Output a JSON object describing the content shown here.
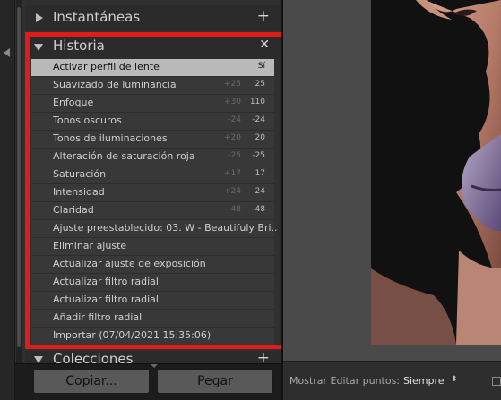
{
  "panel": {
    "snapshots_title": "Instantáneas",
    "history_title": "Historia",
    "collections_title": "Colecciones",
    "history_items": [
      {
        "label": "Activar perfil de lente",
        "delta": "",
        "value": "Sí",
        "selected": true
      },
      {
        "label": "Suavizado de luminancia",
        "delta": "+25",
        "value": "25"
      },
      {
        "label": "Enfoque",
        "delta": "+30",
        "value": "110"
      },
      {
        "label": "Tonos oscuros",
        "delta": "-24",
        "value": "-24"
      },
      {
        "label": "Tonos de iluminaciones",
        "delta": "+20",
        "value": "20"
      },
      {
        "label": "Alteración de saturación roja",
        "delta": "-25",
        "value": "-25"
      },
      {
        "label": "Saturación",
        "delta": "+17",
        "value": "17"
      },
      {
        "label": "Intensidad",
        "delta": "+24",
        "value": "24"
      },
      {
        "label": "Claridad",
        "delta": "-48",
        "value": "-48"
      },
      {
        "label": "Ajuste preestablecido: 03. W - Beautifuly Bri...",
        "delta": "",
        "value": ""
      },
      {
        "label": "Eliminar ajuste",
        "delta": "",
        "value": ""
      },
      {
        "label": "Actualizar ajuste de exposición",
        "delta": "",
        "value": ""
      },
      {
        "label": "Actualizar filtro radial",
        "delta": "",
        "value": ""
      },
      {
        "label": "Actualizar filtro radial",
        "delta": "",
        "value": ""
      },
      {
        "label": "Añadir filtro radial",
        "delta": "",
        "value": ""
      },
      {
        "label": "Importar (07/04/2021 15:35:06)",
        "delta": "",
        "value": ""
      }
    ]
  },
  "buttons": {
    "copy_label": "Copiar...",
    "paste_label": "Pegar"
  },
  "toolbar": {
    "edit_points_label": "Mostrar Editar puntos:",
    "edit_points_value": "Siempre"
  },
  "colors": {
    "highlight": "#e01b1b",
    "selected_row": "#b9b9b9"
  },
  "icons": [
    "chevron-left-icon",
    "triangle-right-icon",
    "triangle-down-icon",
    "plus-icon",
    "close-icon",
    "chevron-down-icon"
  ]
}
